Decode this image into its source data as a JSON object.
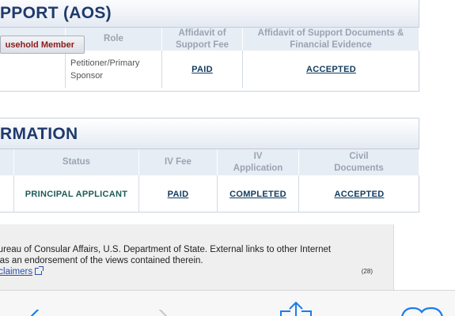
{
  "aos": {
    "title": "PPORT (AOS)",
    "household_button": "usehold Member",
    "headers": {
      "role": "Role",
      "fee": "Affidavit of Support Fee",
      "documents": "Affidavit of Support Documents & Financial Evidence"
    },
    "row": {
      "role": "Petitioner/Primary Sponsor",
      "fee": "PAID",
      "documents": "ACCEPTED"
    }
  },
  "applicant": {
    "title": "RMATION",
    "headers": {
      "status": "Status",
      "iv_fee": "IV Fee",
      "iv_application": "IV Application",
      "civil_documents": "Civil Documents"
    },
    "row": {
      "status": "PRINCIPAL APPLICANT",
      "iv_fee": "PAID",
      "iv_application": "COMPLETED",
      "civil_documents": "ACCEPTED"
    }
  },
  "footer": {
    "line1": "Bureau of Consular Affairs, U.S. Department of State. External links to other Internet",
    "line2": "d as an endorsement of the views contained therein.",
    "disclaimers_link": "isclaimers",
    "counter": "(28)"
  },
  "toolbar": {
    "icons": [
      "back-icon",
      "forward-icon",
      "share-icon",
      "bookmarks-icon"
    ]
  },
  "colors": {
    "title_text": "#1f3a6d",
    "link_text": "#123c62",
    "status_teal": "#1d5c56",
    "household_red": "#8a1a1a",
    "toolbar_blue": "#1a7ee6"
  }
}
